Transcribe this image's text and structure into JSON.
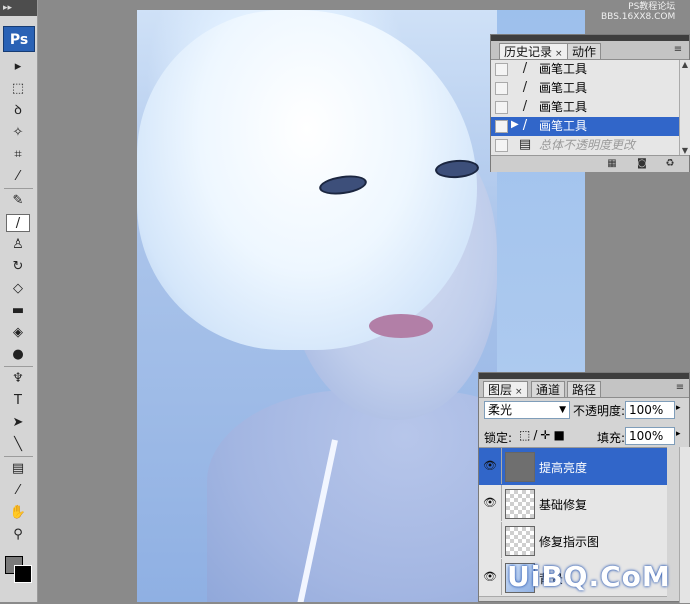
{
  "app": {
    "logo": "Ps"
  },
  "toolbar": {
    "grip": "▸▸",
    "tools": [
      {
        "name": "move-tool-icon",
        "glyph": "▸"
      },
      {
        "name": "marquee-tool-icon",
        "glyph": "⬚"
      },
      {
        "name": "lasso-tool-icon",
        "glyph": "ꝺ"
      },
      {
        "name": "magic-wand-tool-icon",
        "glyph": "✧"
      },
      {
        "name": "crop-tool-icon",
        "glyph": "⌗"
      },
      {
        "name": "eyedropper-tool-icon",
        "glyph": "⁄"
      },
      {
        "name": "healing-brush-tool-icon",
        "glyph": "✎"
      },
      {
        "name": "brush-tool-icon",
        "glyph": "/"
      },
      {
        "name": "clone-stamp-tool-icon",
        "glyph": "♙"
      },
      {
        "name": "history-brush-tool-icon",
        "glyph": "↻"
      },
      {
        "name": "eraser-tool-icon",
        "glyph": "◇"
      },
      {
        "name": "gradient-tool-icon",
        "glyph": "▬"
      },
      {
        "name": "blur-tool-icon",
        "glyph": "◈"
      },
      {
        "name": "dodge-tool-icon",
        "glyph": "●"
      },
      {
        "name": "pen-tool-icon",
        "glyph": "♆"
      },
      {
        "name": "type-tool-icon",
        "glyph": "T"
      },
      {
        "name": "path-selection-tool-icon",
        "glyph": "➤"
      },
      {
        "name": "line-tool-icon",
        "glyph": "╲"
      },
      {
        "name": "notes-tool-icon",
        "glyph": "▤"
      },
      {
        "name": "eyedropper2-tool-icon",
        "glyph": "⁄"
      },
      {
        "name": "hand-tool-icon",
        "glyph": "✋"
      },
      {
        "name": "zoom-tool-icon",
        "glyph": "⚲"
      }
    ]
  },
  "history": {
    "tabs": [
      "历史记录",
      "动作"
    ],
    "close": "×",
    "items": [
      {
        "label": "画笔工具",
        "state": "normal"
      },
      {
        "label": "画笔工具",
        "state": "normal"
      },
      {
        "label": "画笔工具",
        "state": "normal"
      },
      {
        "label": "画笔工具",
        "state": "selected"
      },
      {
        "label": "总体不透明度更改",
        "state": "dimmed"
      }
    ]
  },
  "layers": {
    "tabs": [
      "图层",
      "通道",
      "路径"
    ],
    "close": "×",
    "blend_mode": "柔光",
    "opacity_label": "不透明度:",
    "opacity_value": "100%",
    "lock_label": "锁定:",
    "fill_label": "填充:",
    "fill_value": "100%",
    "items": [
      {
        "name": "提高亮度",
        "visible": true,
        "selected": true
      },
      {
        "name": "基础修复",
        "visible": true,
        "selected": false
      },
      {
        "name": "修复指示图",
        "visible": false,
        "selected": false
      },
      {
        "name": "背景",
        "visible": true,
        "selected": false
      }
    ]
  },
  "watermark": {
    "top_line1": "PS教程论坛",
    "top_line2": "BBS.16XX8.COM",
    "bottom": "UiBQ.CoM"
  },
  "colors": {
    "selection": "#3166c9",
    "panel": "#d4d4d4",
    "foreground": "#7a7a7a",
    "background": "#000000"
  }
}
